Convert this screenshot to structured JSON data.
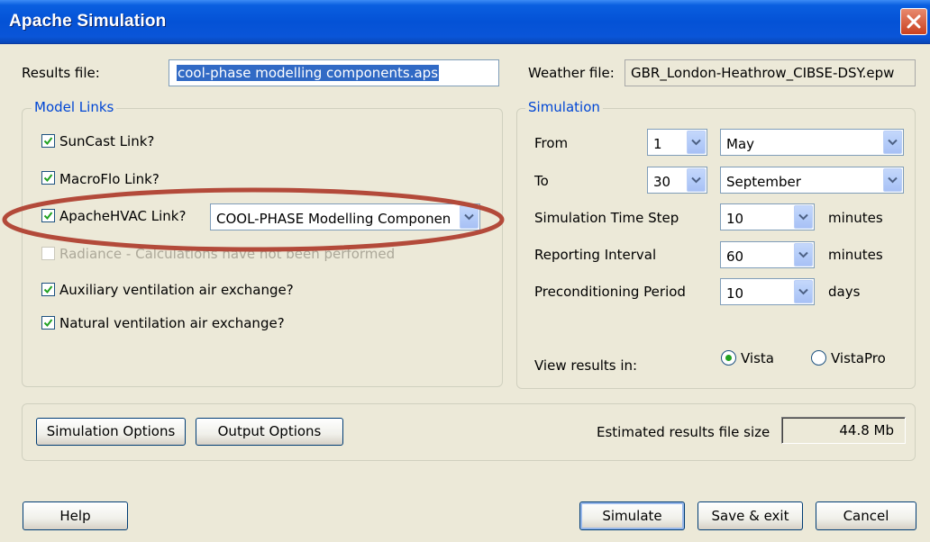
{
  "window": {
    "title": "Apache Simulation"
  },
  "results_file": {
    "label": "Results file:",
    "value": "cool-phase modelling components.aps"
  },
  "weather_file": {
    "label": "Weather file:",
    "value": "GBR_London-Heathrow_CIBSE-DSY.epw"
  },
  "model_links": {
    "legend": "Model Links",
    "suncast": {
      "label": "SunCast Link?",
      "checked": true
    },
    "macroflo": {
      "label": "MacroFlo Link?",
      "checked": true
    },
    "apachehvac": {
      "label": "ApacheHVAC Link?",
      "checked": true,
      "selected": "COOL-PHASE Modelling Componen"
    },
    "radiance": {
      "label": "Radiance - Calculations have not been performed",
      "checked": false,
      "enabled": false
    },
    "auxiliary": {
      "label": "Auxiliary ventilation air exchange?",
      "checked": true
    },
    "natural": {
      "label": "Natural ventilation air exchange?",
      "checked": true
    }
  },
  "simulation": {
    "legend": "Simulation",
    "from": {
      "label": "From",
      "day": "1",
      "month": "May"
    },
    "to": {
      "label": "To",
      "day": "30",
      "month": "September"
    },
    "time_step": {
      "label": "Simulation Time Step",
      "value": "10",
      "unit": "minutes"
    },
    "reporting": {
      "label": "Reporting Interval",
      "value": "60",
      "unit": "minutes"
    },
    "preconditioning": {
      "label": "Preconditioning Period",
      "value": "10",
      "unit": "days"
    },
    "view_results": {
      "label": "View results in:",
      "options": [
        "Vista",
        "VistaPro"
      ],
      "selected": "Vista"
    }
  },
  "options": {
    "simulation_options": "Simulation Options",
    "output_options": "Output Options",
    "estimated_label": "Estimated results file size",
    "estimated_value": "44.8 Mb"
  },
  "footer": {
    "help": "Help",
    "simulate": "Simulate",
    "save_exit": "Save & exit",
    "cancel": "Cancel"
  },
  "annotation": {
    "highlight_color": "#b34a3a"
  },
  "colors": {
    "title_bar": "#0452d6",
    "accent_text": "#0046d5",
    "dialog_bg": "#ece9d8"
  }
}
